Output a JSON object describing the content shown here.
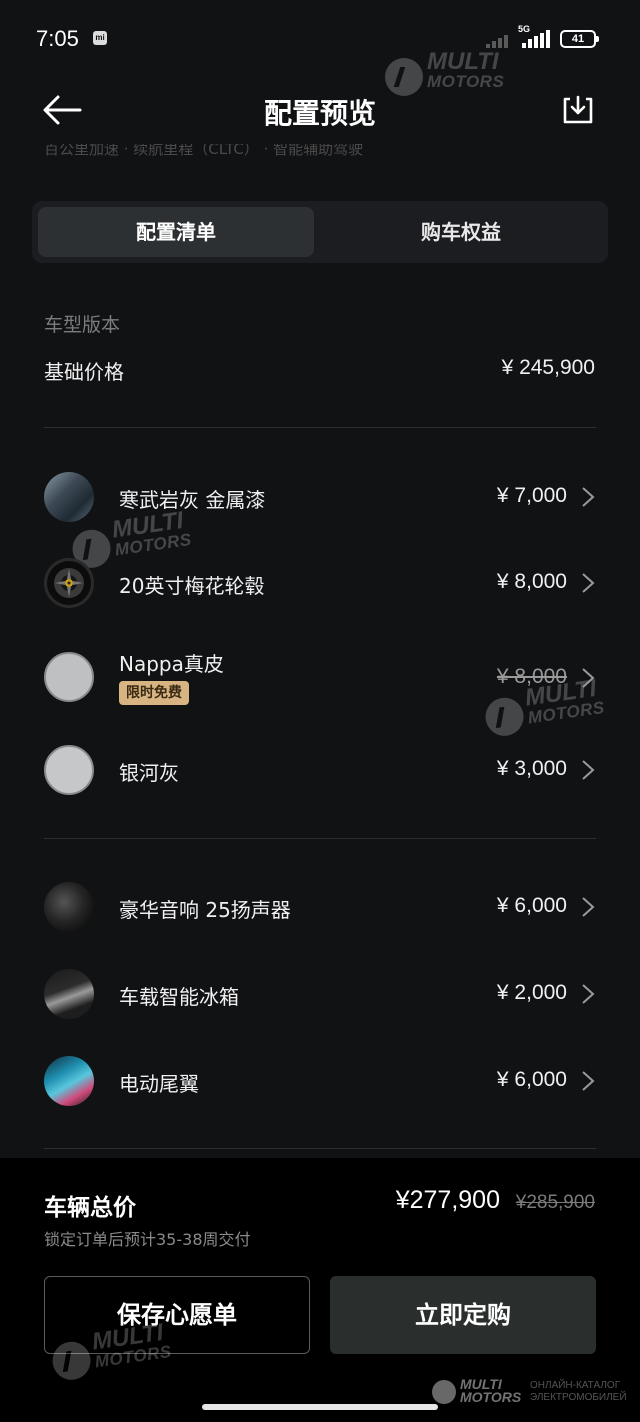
{
  "status_bar": {
    "time": "7:05",
    "mi_label": "mi",
    "network": "5G",
    "battery": "41"
  },
  "header": {
    "title": "配置预览",
    "back_icon": "arrow-left-icon",
    "download_icon": "download-icon",
    "scrolled_text": "百公里加速 · 续航里程（CLTC） · 智能辅助驾驶"
  },
  "watermark": {
    "line1": "MULTI",
    "line2": "MOTORS",
    "corner_line1": "ОНЛАЙН-КАТАЛОГ",
    "corner_line2": "ЭЛЕКТРОМОБИЛЕЙ"
  },
  "tabs": [
    {
      "label": "配置清单",
      "active": true
    },
    {
      "label": "购车权益",
      "active": false
    }
  ],
  "model": {
    "section_label": "车型版本",
    "base_label": "基础价格",
    "base_price": "¥ 245,900"
  },
  "options_group1": [
    {
      "label": "寒武岩灰 金属漆",
      "price": "¥ 7,000",
      "icon": "paint-swatch-icon"
    },
    {
      "label": "20英寸梅花轮毂",
      "price": "¥ 8,000",
      "icon": "wheel-icon"
    },
    {
      "label": "Nappa真皮",
      "price": "¥ 8,000",
      "badge": "限时免费",
      "strikethrough": true,
      "icon": "leather-swatch-icon"
    },
    {
      "label": "银河灰",
      "price": "¥ 3,000",
      "icon": "interior-color-icon"
    }
  ],
  "options_group2": [
    {
      "label": "豪华音响 25扬声器",
      "price": "¥ 6,000",
      "icon": "speaker-icon"
    },
    {
      "label": "车载智能冰箱",
      "price": "¥ 2,000",
      "icon": "fridge-icon"
    },
    {
      "label": "电动尾翼",
      "price": "¥ 6,000",
      "icon": "spoiler-icon"
    }
  ],
  "summary": {
    "total_label": "车辆总价",
    "total_price": "¥277,900",
    "original_price": "¥285,900",
    "delivery_note": "锁定订单后预计35-38周交付",
    "wishlist_button": "保存心愿单",
    "order_button": "立即定购"
  },
  "colors": {
    "background": "#111214",
    "panel": "#1c1d20",
    "active_tab": "#2d3033",
    "badge": "#d8b483",
    "order_button": "#2a2e2d"
  }
}
